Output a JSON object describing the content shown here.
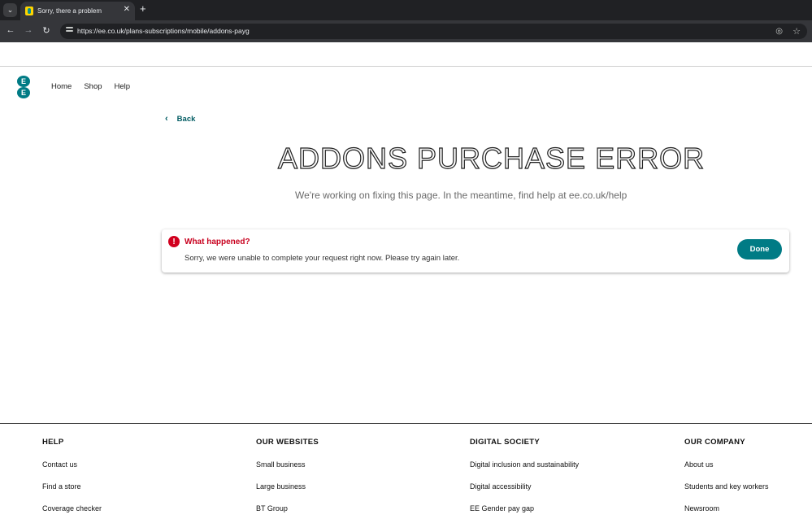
{
  "browser": {
    "tab_title": "Sorry, there a problem",
    "url": "https://ee.co.uk/plans-subscriptions/mobile/addons-payg"
  },
  "header": {
    "logo_letters": [
      "E",
      "E"
    ],
    "nav": [
      "Home",
      "Shop",
      "Help"
    ]
  },
  "main": {
    "back_label": "Back",
    "heading": "ADDONS PURCHASE ERROR",
    "subtext": "We're working on fixing this page. In the meantime, find help at ee.co.uk/help",
    "alert": {
      "title": "What happened?",
      "message": "Sorry, we were unable to complete your request right now. Please try again later.",
      "button": "Done"
    }
  },
  "footer": {
    "columns": [
      {
        "title": "HELP",
        "links": [
          "Contact us",
          "Find a store",
          "Coverage checker"
        ]
      },
      {
        "title": "OUR WEBSITES",
        "links": [
          "Small business",
          "Large business",
          "BT Group"
        ]
      },
      {
        "title": "DIGITAL SOCIETY",
        "links": [
          "Digital inclusion and sustainability",
          "Digital accessibility",
          "EE Gender pay gap"
        ]
      },
      {
        "title": "OUR COMPANY",
        "links": [
          "About us",
          "Students and key workers",
          "Newsroom"
        ]
      }
    ]
  },
  "colors": {
    "brand_teal": "#007b85",
    "error_red": "#d1001f"
  }
}
